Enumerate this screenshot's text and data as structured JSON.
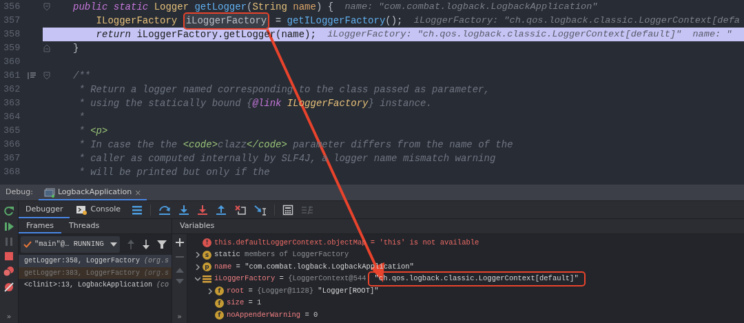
{
  "editor": {
    "lines": [
      {
        "number": "356",
        "fold_start": true,
        "tokens": [
          {
            "text": "public static ",
            "kind": "keyword"
          },
          {
            "text": "Logger ",
            "kind": "type"
          },
          {
            "text": "getLogger",
            "kind": "method"
          },
          {
            "text": "(",
            "kind": "plain"
          },
          {
            "text": "String ",
            "kind": "type"
          },
          {
            "text": "name",
            "kind": "param"
          },
          {
            "text": ") {",
            "kind": "plain"
          },
          {
            "text": "  name: \"com.combat.logback.LogbackApplication\"",
            "kind": "hint"
          }
        ]
      },
      {
        "number": "357",
        "tokens": [
          {
            "text": "    ILoggerFactory ",
            "kind": "type"
          },
          {
            "text": "iLoggerFactory",
            "kind": "plain",
            "boxed": true
          },
          {
            "text": " = ",
            "kind": "plain"
          },
          {
            "text": "getILoggerFactory",
            "kind": "method"
          },
          {
            "text": "();",
            "kind": "plain"
          },
          {
            "text": "  iLoggerFactory: \"ch.qos.logback.classic.LoggerContext[defa",
            "kind": "hint"
          }
        ]
      },
      {
        "number": "358",
        "highlighted": true,
        "tokens": [
          {
            "text": "    return",
            "kind": "keyword"
          },
          {
            "text": " iLoggerFactory.getLogger(name);",
            "kind": "plain"
          },
          {
            "text": "  iLoggerFactory: \"ch.qos.logback.classic.LoggerContext[default]\"  name: \"",
            "kind": "hint"
          }
        ]
      },
      {
        "number": "359",
        "fold_end": true,
        "tokens": [
          {
            "text": "}",
            "kind": "plain"
          }
        ]
      },
      {
        "number": "360"
      },
      {
        "number": "361",
        "fold_start": true,
        "doc_toggle": true,
        "tokens": [
          {
            "text": "/**",
            "kind": "comment"
          }
        ]
      },
      {
        "number": "362",
        "tokens": [
          {
            "text": " * Return a logger named corresponding to the class passed as parameter,",
            "kind": "comment"
          }
        ]
      },
      {
        "number": "363",
        "tokens": [
          {
            "text": " * using the statically bound {",
            "kind": "comment"
          },
          {
            "text": "@link",
            "kind": "doctag"
          },
          {
            "text": " ILoggerFactory",
            "kind": "doctype"
          },
          {
            "text": "} instance.",
            "kind": "comment"
          }
        ]
      },
      {
        "number": "364",
        "tokens": [
          {
            "text": " *",
            "kind": "comment"
          }
        ]
      },
      {
        "number": "365",
        "tokens": [
          {
            "text": " * ",
            "kind": "comment"
          },
          {
            "text": "<p>",
            "kind": "tag"
          }
        ]
      },
      {
        "number": "366",
        "tokens": [
          {
            "text": " * In case the the ",
            "kind": "comment"
          },
          {
            "text": "<code>",
            "kind": "tag"
          },
          {
            "text": "clazz",
            "kind": "comment"
          },
          {
            "text": "</code>",
            "kind": "tag"
          },
          {
            "text": " parameter differs from the name of the",
            "kind": "comment"
          }
        ]
      },
      {
        "number": "367",
        "tokens": [
          {
            "text": " * caller as computed internally by SLF4J, a logger name mismatch warning",
            "kind": "comment"
          }
        ]
      },
      {
        "number": "368",
        "tokens": [
          {
            "text": " * will be printed but only if the",
            "kind": "comment"
          }
        ]
      }
    ]
  },
  "debug": {
    "label": "Debug:",
    "session_tab": {
      "title": "LogbackApplication",
      "close": "×",
      "selected": true
    },
    "side_tools": [
      {
        "kind": "rerun",
        "disabled": false
      },
      {
        "kind": "resume",
        "disabled": false
      },
      {
        "kind": "pause",
        "disabled": true
      },
      {
        "kind": "stop",
        "disabled": false
      },
      {
        "kind": "breakpoints",
        "disabled": false
      },
      {
        "kind": "mute",
        "disabled": false
      }
    ],
    "side_more": "»",
    "tabs": [
      {
        "label": "Debugger",
        "selected": true
      },
      {
        "label": "Console",
        "selected": false
      }
    ],
    "toolbar": [
      {
        "kind": "menu",
        "disabled": false
      },
      {
        "kind": "step_over",
        "disabled": false
      },
      {
        "kind": "step_into",
        "disabled": false
      },
      {
        "kind": "force_step_into",
        "disabled": false
      },
      {
        "kind": "step_out",
        "disabled": false
      },
      {
        "kind": "drop_frame",
        "disabled": false
      },
      {
        "kind": "run_to_cursor",
        "disabled": false
      },
      {
        "kind": "evaluate",
        "disabled": false
      },
      {
        "kind": "trace",
        "disabled": true
      }
    ],
    "frame_tabs": [
      {
        "label": "Frames",
        "selected": true
      },
      {
        "label": "Threads",
        "selected": false
      }
    ],
    "thread": {
      "value": "\"main\"@… RUNNING"
    },
    "frame_tools": [
      {
        "kind": "up",
        "disabled": true
      },
      {
        "kind": "down",
        "disabled": false
      },
      {
        "kind": "filter",
        "disabled": false
      }
    ],
    "frames": [
      {
        "text": "getLogger:358, LoggerFactory",
        "detail": "(org.s",
        "kind": "app",
        "selected": true
      },
      {
        "text": "getLogger:383, LoggerFactory",
        "detail": "(org.s",
        "kind": "library",
        "selected": false
      },
      {
        "text": "<clinit>:13, LogbackApplication",
        "detail": "(co",
        "kind": "app",
        "selected": false
      }
    ],
    "variables_title": "Variables",
    "var_tools": [
      {
        "kind": "add",
        "disabled": false
      },
      {
        "kind": "remove",
        "disabled": true
      },
      {
        "kind": "up",
        "disabled": true
      },
      {
        "kind": "down",
        "disabled": true
      }
    ],
    "var_more": "»",
    "variables": [
      {
        "kind": "error",
        "glyph": "!",
        "parts": [
          {
            "text": "this.defaultLoggerContext.objectMap = 'this' is not available",
            "kind": "error"
          }
        ]
      },
      {
        "expanded": false,
        "kind": "static",
        "glyph": "s",
        "parts": [
          {
            "text": "static",
            "kind": "plain"
          },
          {
            "text": " members of LoggerFactory",
            "kind": "muted"
          }
        ]
      },
      {
        "expanded": false,
        "kind": "param",
        "glyph": "p",
        "parts": [
          {
            "text": "name",
            "kind": "name"
          },
          {
            "text": " = ",
            "kind": "plain"
          },
          {
            "text": "\"com.combat.logback.LogbackApplication\"",
            "kind": "string"
          }
        ]
      },
      {
        "expanded": true,
        "kind": "list",
        "parts": [
          {
            "text": "iLoggerFactory",
            "kind": "name"
          },
          {
            "text": " = ",
            "kind": "plain"
          },
          {
            "text": "{LoggerContext@544",
            "kind": "muted"
          },
          {
            "text": "\"ch.qos.logback.classic.LoggerContext[default]\"",
            "kind": "string",
            "boxed": true
          }
        ],
        "children": [
          {
            "expanded": false,
            "kind": "field",
            "glyph": "f",
            "parts": [
              {
                "text": "root",
                "kind": "name"
              },
              {
                "text": " = ",
                "kind": "plain"
              },
              {
                "text": "{Logger@1128} ",
                "kind": "muted"
              },
              {
                "text": "\"Logger[ROOT]\"",
                "kind": "string"
              }
            ]
          },
          {
            "kind": "field",
            "glyph": "f",
            "parts": [
              {
                "text": "size",
                "kind": "name"
              },
              {
                "text": " = 1",
                "kind": "plain"
              }
            ]
          },
          {
            "kind": "field",
            "glyph": "f",
            "parts": [
              {
                "text": "noAppenderWarning",
                "kind": "name"
              },
              {
                "text": " = 0",
                "kind": "plain"
              }
            ]
          }
        ]
      }
    ]
  }
}
